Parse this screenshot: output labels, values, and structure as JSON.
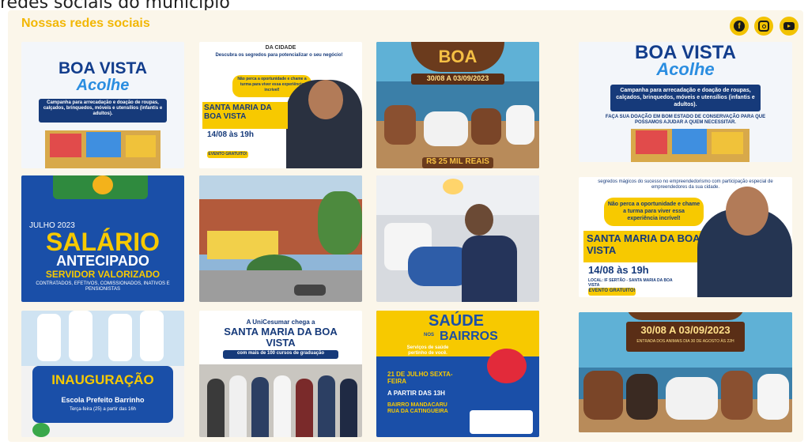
{
  "page": {
    "heading": "redes sociais do município"
  },
  "section": {
    "title": "Nossas redes sociais"
  },
  "social": [
    {
      "name": "facebook",
      "icon": "facebook-icon",
      "glyph": "f"
    },
    {
      "name": "instagram",
      "icon": "instagram-icon"
    },
    {
      "name": "youtube",
      "icon": "youtube-icon"
    }
  ],
  "colors": {
    "accent": "#f2c200",
    "panel": "#fbf6ea",
    "title": "#f2b705",
    "navy": "#163a7a"
  },
  "posts": {
    "p1": {
      "line1": "BOA VISTA",
      "line2": "Acolhe",
      "sub": "Campanha para arrecadação e doação de roupas, calçados, brinquedos, móveis e utensílios (infantis e adultos)."
    },
    "p2": {
      "top": "DA CIDADE",
      "headline": "Descubra os segredos para potencializar o seu negócio!",
      "callout": "Não perca a oportunidade e chame a turma para viver essa experiência incrível!",
      "city": "SANTA MARIA DA BOA VISTA",
      "date": "14/08 às 19h",
      "badge": "EVENTO GRATUITO!"
    },
    "p3": {
      "title": "BOA",
      "dates": "30/08 A 03/09/2023",
      "price": "R$ 25 MIL REAIS"
    },
    "p4": {
      "line1": "BOA VISTA",
      "line2": "Acolhe",
      "sub": "Campanha para arrecadação e doação de roupas, calçados, brinquedos, móveis e utensílios (infantis e adultos).",
      "foot": "FAÇA SUA DOAÇÃO EM BOM ESTADO DE CONSERVAÇÃO PARA QUE POSSAMOS AJUDAR A QUEM NECESSITAR."
    },
    "p5": {
      "month": "JULHO 2023",
      "big": "SALÁRIO",
      "mid": "ANTECIPADO",
      "sub": "SERVIDOR VALORIZADO",
      "foot": "CONTRATADOS, EFETIVOS, COMISSIONADOS, INATIVOS E PENSIONISTAS"
    },
    "p8": {
      "top": "segredos mágicos do sucesso no empreendedorismo com participação especial de empreendedores da sua cidade.",
      "callout": "Não perca a oportunidade e chame a turma para viver essa experiência incrível!",
      "city": "SANTA MARIA DA BOA VISTA",
      "date": "14/08 às 19h",
      "local": "LOCAL: IF SERTÃO - SANTA MARIA DA BOA VISTA",
      "badge": "EVENTO GRATUITO!"
    },
    "p9": {
      "title": "INAUGURAÇÃO",
      "school": "Escola Prefeito Barrinho",
      "when": "Terça-feira (25) a partir das 16h"
    },
    "p10": {
      "top": "A UniCesumar chega a",
      "city": "SANTA MARIA DA BOA VISTA",
      "sub": "com mais de 100 cursos de graduação"
    },
    "p11": {
      "title": "SAÚDE",
      "nos": "NOS",
      "bairros": "BAIRROS",
      "tag": "Serviços de saúde pertinho de você.",
      "date": "21 DE JULHO SEXTA-FEIRA",
      "time": "A PARTIR DAS 13H",
      "place": "BAIRRO MANDACARU RUA DA CATINGUEIRA"
    },
    "p12": {
      "dates": "30/08 A 03/09/2023",
      "sub": "ENTRADA DOS ANIMAIS DIA 30 DE AGOSTO ÀS 22H"
    }
  }
}
